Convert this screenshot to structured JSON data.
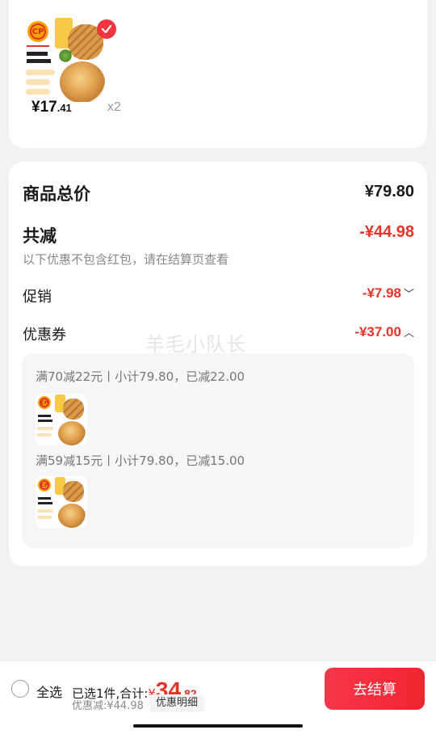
{
  "product": {
    "thumb_brand_text": "CP",
    "price_symbol": "¥",
    "price_int": "17",
    "price_dec": ".41",
    "quantity": "x2",
    "selected": true
  },
  "summary": {
    "total_label": "商品总价",
    "total_value": "¥79.80",
    "reduce_label": "共减",
    "reduce_value": "-¥44.98",
    "note": "以下优惠不包含红包，请在结算页查看",
    "promo_label": "促销",
    "promo_value": "-¥7.98",
    "coupon_label": "优惠券",
    "coupon_value": "-¥37.00",
    "watermark": "羊毛小队长"
  },
  "coupons": [
    {
      "line": "满70减22元丨小计79.80，已减22.00"
    },
    {
      "line": "满59减15元丨小计79.80，已减15.00"
    }
  ],
  "bottom": {
    "select_all": "全选",
    "selected_text": "已选1件,合计:",
    "currency": "¥",
    "total_int": "34",
    "total_dec": ".82",
    "saved_text": "优惠减:¥44.98",
    "detail_button": "优惠明细",
    "checkout_button": "去结算"
  },
  "colors": {
    "accent_red": "#e4342a",
    "checkout_red": "#f0262f"
  }
}
